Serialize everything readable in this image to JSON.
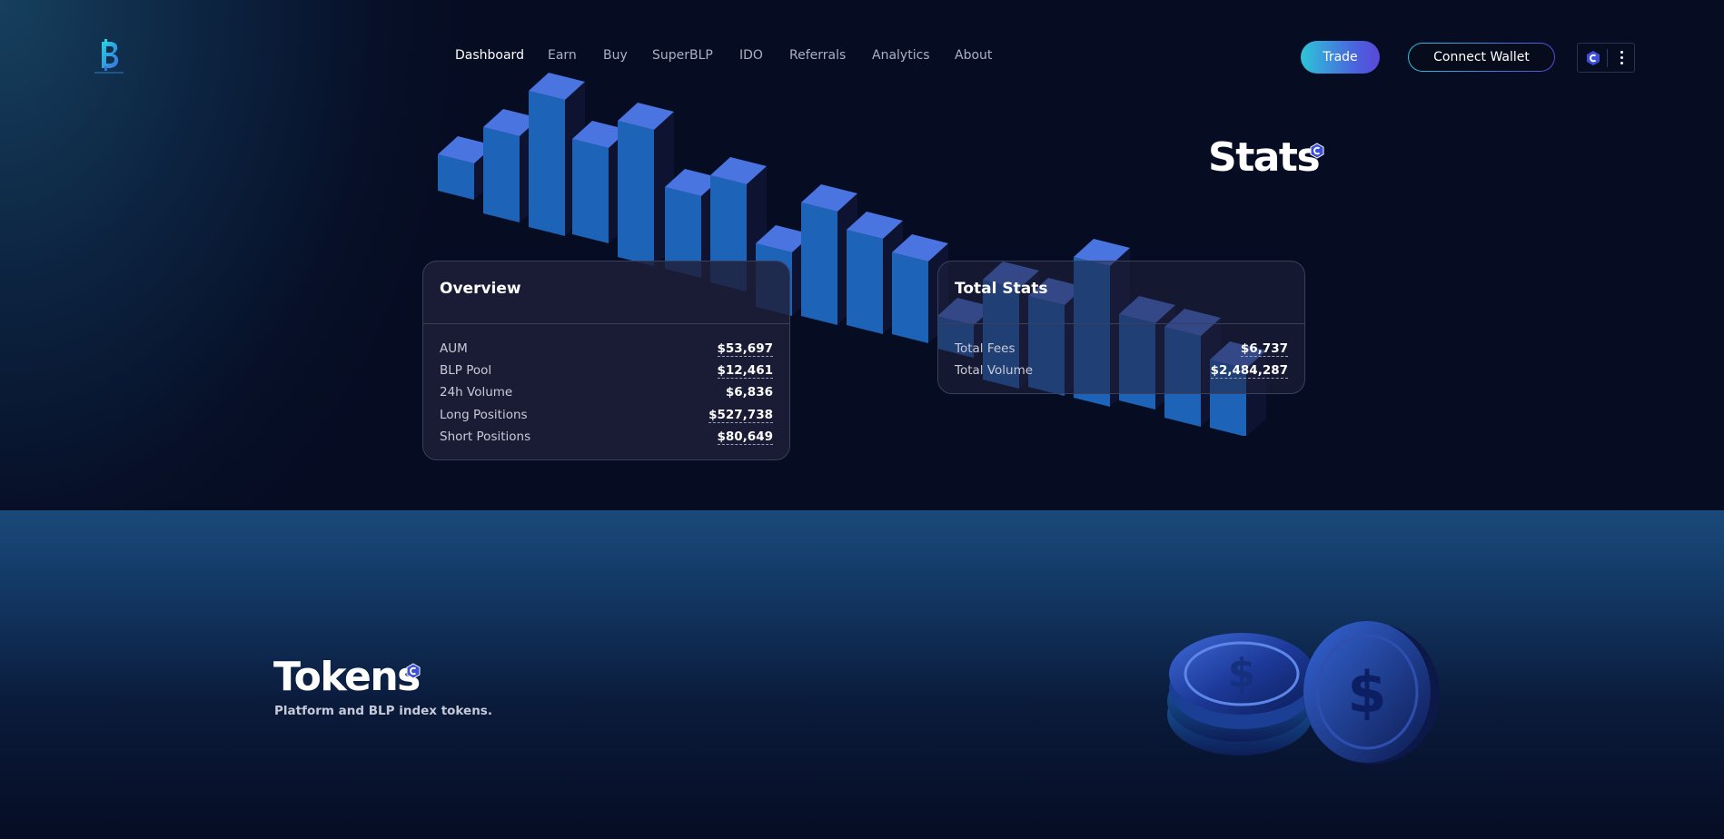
{
  "nav": {
    "items": [
      {
        "label": "Dashboard",
        "active": true
      },
      {
        "label": "Earn",
        "active": false
      },
      {
        "label": "Buy",
        "active": false
      },
      {
        "label": "SuperBLP",
        "active": false
      },
      {
        "label": "IDO",
        "active": false
      },
      {
        "label": "Referrals",
        "active": false
      },
      {
        "label": "Analytics",
        "active": false
      },
      {
        "label": "About",
        "active": false
      }
    ],
    "trade_label": "Trade",
    "connect_label": "Connect Wallet",
    "network_icon": "network-icon",
    "more_icon": "more-vertical-icon"
  },
  "stats": {
    "title": "Stats"
  },
  "overview": {
    "title": "Overview",
    "rows": [
      {
        "label": "AUM",
        "value": "$53,697"
      },
      {
        "label": "BLP Pool",
        "value": "$12,461"
      },
      {
        "label": "24h Volume",
        "value": "$6,836"
      },
      {
        "label": "Long Positions",
        "value": "$527,738"
      },
      {
        "label": "Short Positions",
        "value": "$80,649"
      }
    ]
  },
  "total_stats": {
    "title": "Total Stats",
    "rows": [
      {
        "label": "Total Fees",
        "value": "$6,737"
      },
      {
        "label": "Total Volume",
        "value": "$2,484,287"
      }
    ]
  },
  "tokens": {
    "title": "Tokens",
    "subtitle": "Platform and BLP index tokens."
  },
  "colors": {
    "accent_start": "#2ec4d8",
    "accent_end": "#5a48d8",
    "background": "#050b1e"
  }
}
